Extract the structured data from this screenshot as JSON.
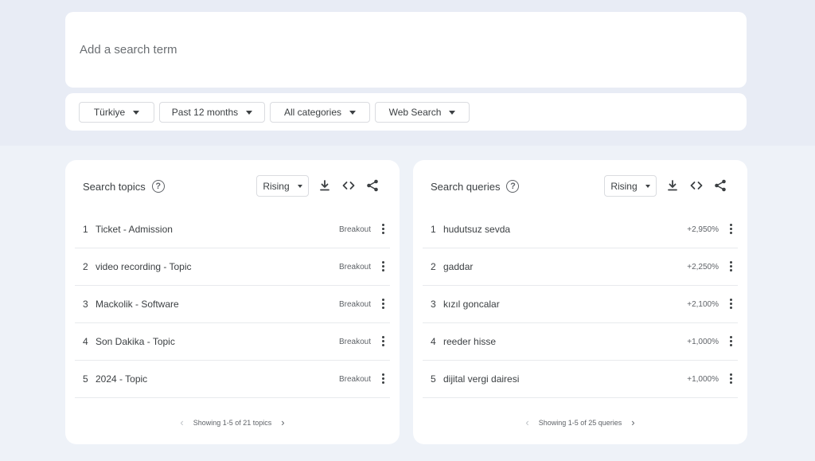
{
  "search": {
    "placeholder": "Add a search term"
  },
  "filters": {
    "region": "Türkiye",
    "time": "Past 12 months",
    "category": "All categories",
    "property": "Web Search"
  },
  "topics": {
    "title": "Search topics",
    "sort": "Rising",
    "rows": [
      {
        "num": "1",
        "label": "Ticket - Admission",
        "value": "Breakout"
      },
      {
        "num": "2",
        "label": "video recording - Topic",
        "value": "Breakout"
      },
      {
        "num": "3",
        "label": "Mackolik - Software",
        "value": "Breakout"
      },
      {
        "num": "4",
        "label": "Son Dakika - Topic",
        "value": "Breakout"
      },
      {
        "num": "5",
        "label": "2024 - Topic",
        "value": "Breakout"
      }
    ],
    "pager": "Showing 1-5 of 21 topics"
  },
  "queries": {
    "title": "Search queries",
    "sort": "Rising",
    "rows": [
      {
        "num": "1",
        "label": "hudutsuz sevda",
        "value": "+2,950%"
      },
      {
        "num": "2",
        "label": "gaddar",
        "value": "+2,250%"
      },
      {
        "num": "3",
        "label": "kızıl goncalar",
        "value": "+2,100%"
      },
      {
        "num": "4",
        "label": "reeder hisse",
        "value": "+1,000%"
      },
      {
        "num": "5",
        "label": "dijital vergi dairesi",
        "value": "+1,000%"
      }
    ],
    "pager": "Showing 1-5 of 25 queries"
  },
  "icons": {
    "help": "help-circle-icon",
    "download": "download-icon",
    "embed": "embed-code-icon",
    "share": "share-icon",
    "more": "more-vert-icon"
  },
  "colors": {
    "background": "#eef2f8",
    "card": "#ffffff",
    "text": "#3c4043"
  }
}
